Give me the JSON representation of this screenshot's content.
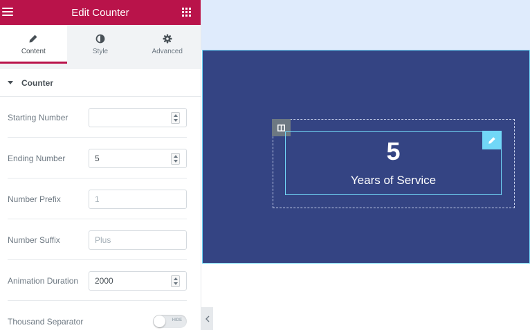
{
  "panel": {
    "title": "Edit Counter",
    "tabs": [
      {
        "label": "Content",
        "icon": "pencil-icon",
        "active": true
      },
      {
        "label": "Style",
        "icon": "half-circle-icon",
        "active": false
      },
      {
        "label": "Advanced",
        "icon": "gear-icon",
        "active": false
      }
    ],
    "section": {
      "label": "Counter"
    },
    "controls": {
      "starting_number": {
        "label": "Starting Number",
        "value": ""
      },
      "ending_number": {
        "label": "Ending Number",
        "value": "5"
      },
      "number_prefix": {
        "label": "Number Prefix",
        "placeholder": "1"
      },
      "number_suffix": {
        "label": "Number Suffix",
        "placeholder": "Plus"
      },
      "animation_duration": {
        "label": "Animation Duration",
        "value": "2000"
      },
      "thousand_separator": {
        "label": "Thousand Separator",
        "toggle_text": "HIDE",
        "enabled": false
      }
    }
  },
  "preview": {
    "counter": {
      "number": "5",
      "title": "Years of Service"
    }
  },
  "colors": {
    "brand": "#b9134a",
    "section_bg": "#344483",
    "top_strip": "#dfebfc",
    "selection": "#71d7f7"
  }
}
